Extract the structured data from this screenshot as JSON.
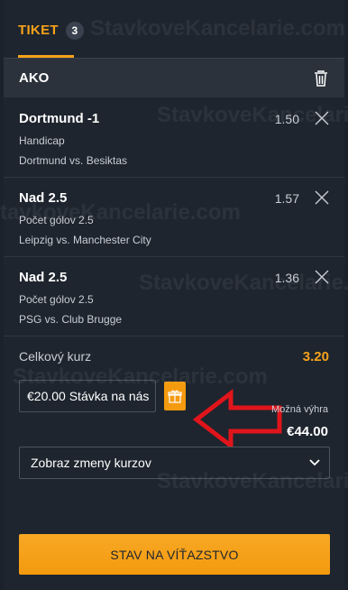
{
  "tab": {
    "label": "TIKET",
    "count": "3"
  },
  "section": {
    "title": "AKO"
  },
  "bets": [
    {
      "name": "Dortmund -1",
      "market": "Handicap",
      "match": "Dortmund vs. Besiktas",
      "odds": "1.50"
    },
    {
      "name": "Nad 2.5",
      "market": "Počet gólov 2.5",
      "match": "Leipzig vs. Manchester City",
      "odds": "1.57"
    },
    {
      "name": "Nad 2.5",
      "market": "Počet gólov 2.5",
      "match": "PSG vs. Club Brugge",
      "odds": "1.36"
    }
  ],
  "total": {
    "label": "Celkový kurz",
    "value": "3.20"
  },
  "stake": {
    "value": "€20.00 Stávka na nás"
  },
  "win": {
    "label": "Možná výhra",
    "value": "€44.00"
  },
  "odds_changes": {
    "selected": "Zobraz zmeny kurzov"
  },
  "submit": {
    "label": "STAV NA VÍŤAZSTVO"
  },
  "watermark": {
    "text": "StavkoveKancelarie.com"
  },
  "colors": {
    "accent": "#f7a21b",
    "background": "#1e252e",
    "arrow": "#e0151b"
  },
  "icons": {
    "trash": "trash-icon",
    "remove": "close-icon",
    "gift": "gift-icon",
    "dropdown": "chevron-down-icon"
  }
}
